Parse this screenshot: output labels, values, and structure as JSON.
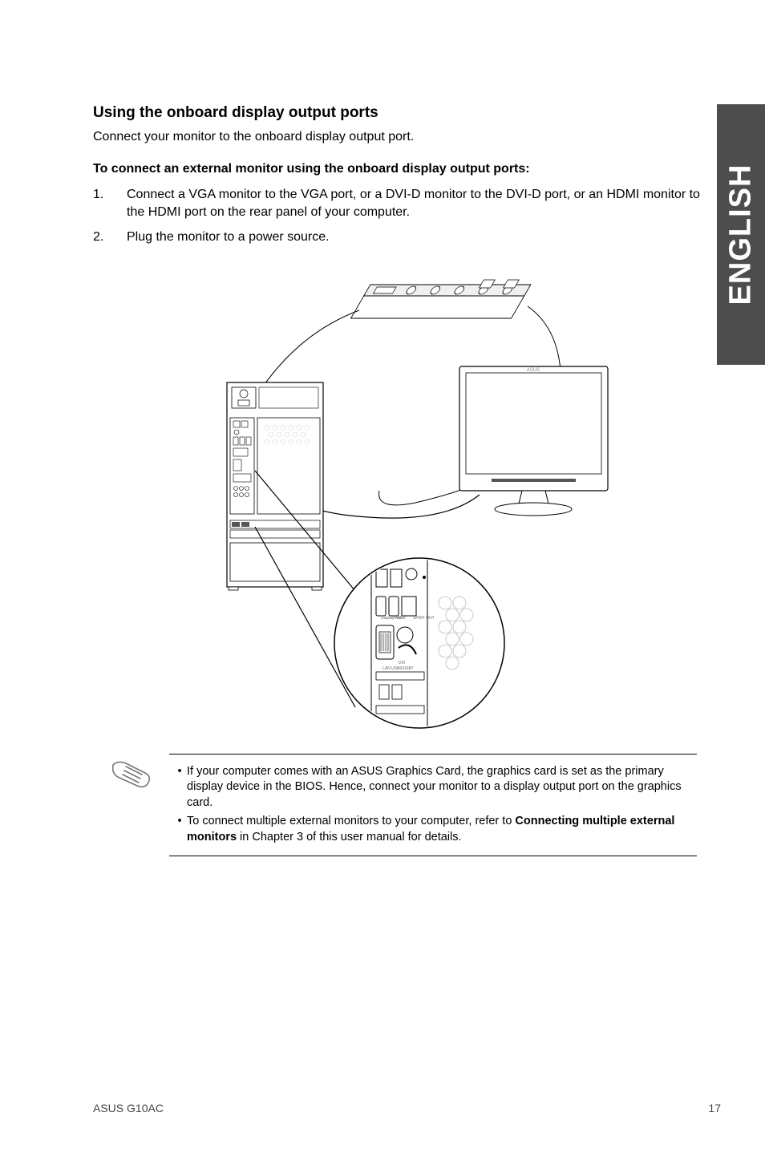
{
  "side_tab": "ENGLISH",
  "section": {
    "title": "Using the onboard display output ports",
    "intro": "Connect your monitor to the onboard display output port.",
    "subhead": "To connect an external monitor using the onboard display output ports:",
    "steps": [
      {
        "num": "1.",
        "text": "Connect a VGA monitor to the VGA port, or a DVI-D monitor to the DVI-D port, or an HDMI monitor to the HDMI port on the rear panel of your computer."
      },
      {
        "num": "2.",
        "text": "Plug the monitor to a power source."
      }
    ]
  },
  "notes": [
    {
      "text_pre": "If your computer comes with an ASUS Graphics Card, the graphics card is set as the primary display device in the BIOS. Hence, connect your monitor to a display output port on the graphics card."
    },
    {
      "text_pre": "To connect multiple external monitors to your computer, refer to ",
      "bold": "Connecting multiple external monitors",
      "text_post": " in Chapter 3 of this user manual for details."
    }
  ],
  "footer": {
    "left": "ASUS G10AC",
    "right": "17"
  }
}
